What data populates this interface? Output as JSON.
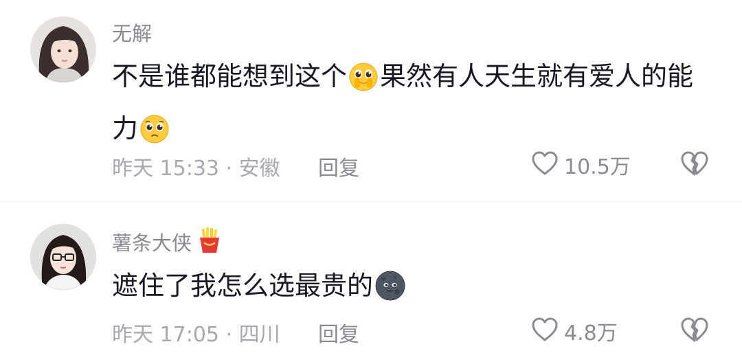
{
  "comments": [
    {
      "username": "无解",
      "content_part1": "不是谁都能想到这个",
      "content_emoji1": "pleading-cover-mouth-emoji",
      "content_part2": "果然有人天生就有爱人的能力",
      "content_emoji2": "pleading-face-emoji",
      "time_location": "昨天 15:33 · 安徽",
      "reply_label": "回复",
      "like_count": "10.5万"
    },
    {
      "username": "薯条大侠",
      "badge_icon": "fries-icon",
      "content_part1": "遮住了我怎么选最贵的",
      "content_emoji1": "dark-moon-face-emoji",
      "time_location": "昨天 17:05 · 四川",
      "reply_label": "回复",
      "like_count": "4.8万"
    }
  ],
  "colors": {
    "text_primary": "#161823",
    "text_secondary": "#8a8b91",
    "text_tertiary": "#a8a9ae",
    "icon_stroke": "#8a8b91"
  }
}
